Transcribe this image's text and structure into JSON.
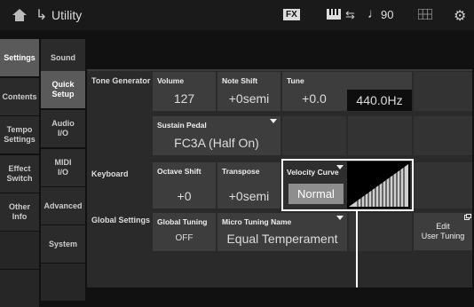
{
  "header": {
    "title": "Utility",
    "fx_badge": "FX",
    "tempo": "90"
  },
  "nav_primary": [
    {
      "label": "Settings"
    },
    {
      "label": "Contents"
    },
    {
      "label": "Tempo\nSettings"
    },
    {
      "label": "Effect\nSwitch"
    },
    {
      "label": "Other\nInfo"
    }
  ],
  "nav_secondary": [
    {
      "label": "Sound"
    },
    {
      "label": "Quick\nSetup"
    },
    {
      "label": "Audio\nI/O"
    },
    {
      "label": "MIDI\nI/O"
    },
    {
      "label": "Advanced"
    },
    {
      "label": "System"
    }
  ],
  "sections": {
    "tone_generator": "Tone Generator",
    "keyboard": "Keyboard",
    "global_settings": "Global Settings"
  },
  "params": {
    "volume": {
      "label": "Volume",
      "value": "127"
    },
    "note_shift": {
      "label": "Note Shift",
      "value": "+0semi"
    },
    "tune": {
      "label": "Tune",
      "value": "+0.0",
      "hz": "440.0Hz"
    },
    "sustain_pedal": {
      "label": "Sustain Pedal",
      "value": "FC3A (Half On)"
    },
    "octave_shift": {
      "label": "Octave Shift",
      "value": "+0"
    },
    "transpose": {
      "label": "Transpose",
      "value": "+0semi"
    },
    "velocity_curve": {
      "label": "Velocity Curve",
      "value": "Normal"
    },
    "global_tuning": {
      "label": "Global Tuning",
      "value": "OFF"
    },
    "micro_tuning_name": {
      "label": "Micro Tuning Name",
      "value": "Equal Temperament"
    },
    "edit_user_tuning": {
      "label": "Edit\nUser Tuning"
    }
  }
}
